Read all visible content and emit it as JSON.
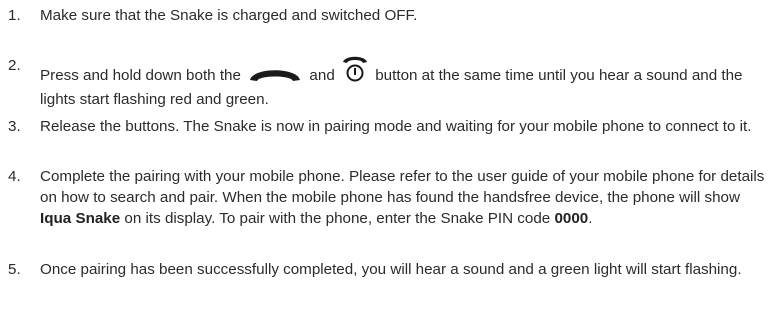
{
  "steps": [
    {
      "num": "1.",
      "text": "Make sure that the Snake is charged and switched OFF."
    },
    {
      "num": "2.",
      "text_a": "Press and hold down both the",
      "text_b": "and",
      "text_c": "button at the same time until you hear a sound and the lights start flashing red and green.",
      "icon_1": "call-end-handset-icon",
      "icon_2": "handset-power-icon"
    },
    {
      "num": "3.",
      "text": "Release the buttons. The Snake is now in pairing mode and waiting for your mobile phone to connect to it."
    },
    {
      "num": "4.",
      "text_a": "Complete the pairing with your mobile phone. Please refer to the user guide of your mobile phone for details on how to search and pair. When the mobile phone has found the handsfree device, the phone will show",
      "bold_device": "Iqua Snake",
      "text_b": "on its display. To pair with the phone, enter the Snake PIN code",
      "bold_pin": "0000",
      "text_c": "."
    },
    {
      "num": "5.",
      "text": "Once pairing has been successfully completed, you will hear a sound and a green light will start flashing."
    }
  ]
}
